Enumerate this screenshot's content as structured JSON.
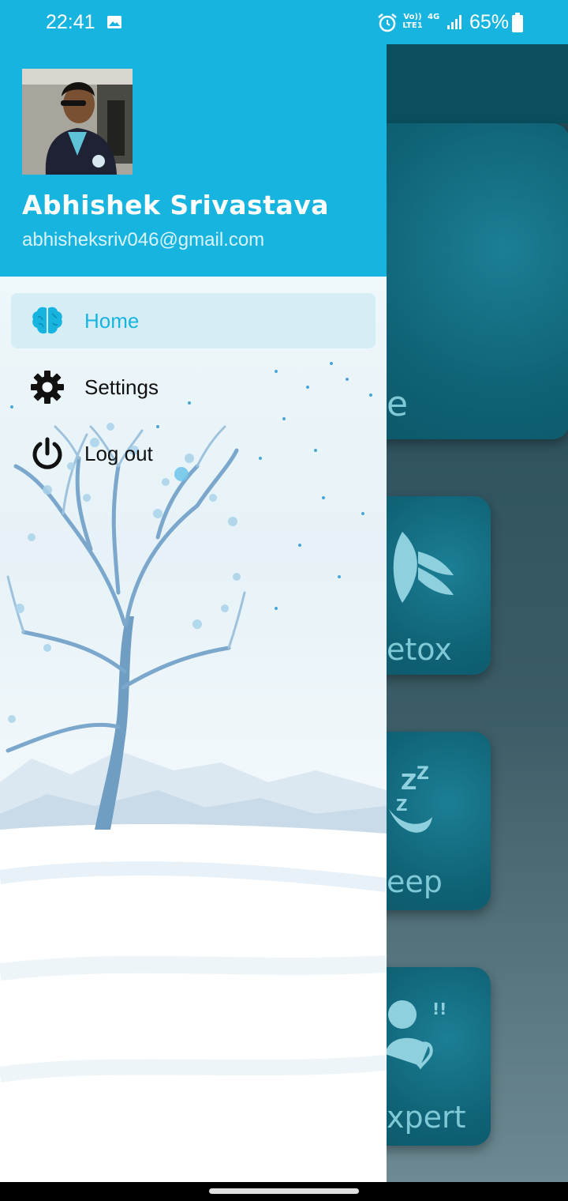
{
  "status_bar": {
    "time": "22:41",
    "network_lines": [
      "Vo)) LTE1"
    ],
    "network_type": "4G",
    "battery_percent": "65%",
    "icons": [
      "gallery-icon",
      "alarm-icon",
      "signal-icon",
      "battery-icon"
    ]
  },
  "drawer": {
    "user": {
      "name": "Abhishek Srivastava",
      "email": "abhisheksriv046@gmail.com"
    },
    "menu": [
      {
        "label": "Home",
        "icon": "brain-icon",
        "active": true
      },
      {
        "label": "Settings",
        "icon": "gear-icon",
        "active": false
      },
      {
        "label": "Log out",
        "icon": "power-icon",
        "active": false
      }
    ]
  },
  "background_app": {
    "cards": [
      {
        "label": "e"
      },
      {
        "label": "etox",
        "icon": "lotus-icon"
      },
      {
        "label": "eep",
        "icon": "moon-sleep-icon"
      },
      {
        "label": "xpert",
        "icon": "expert-icon"
      }
    ]
  },
  "colors": {
    "accent": "#18b4e0",
    "header_bg": "#18b4e0",
    "active_item_bg": "#d5eef6",
    "scrim_app_bar": "#0b4f5f"
  }
}
